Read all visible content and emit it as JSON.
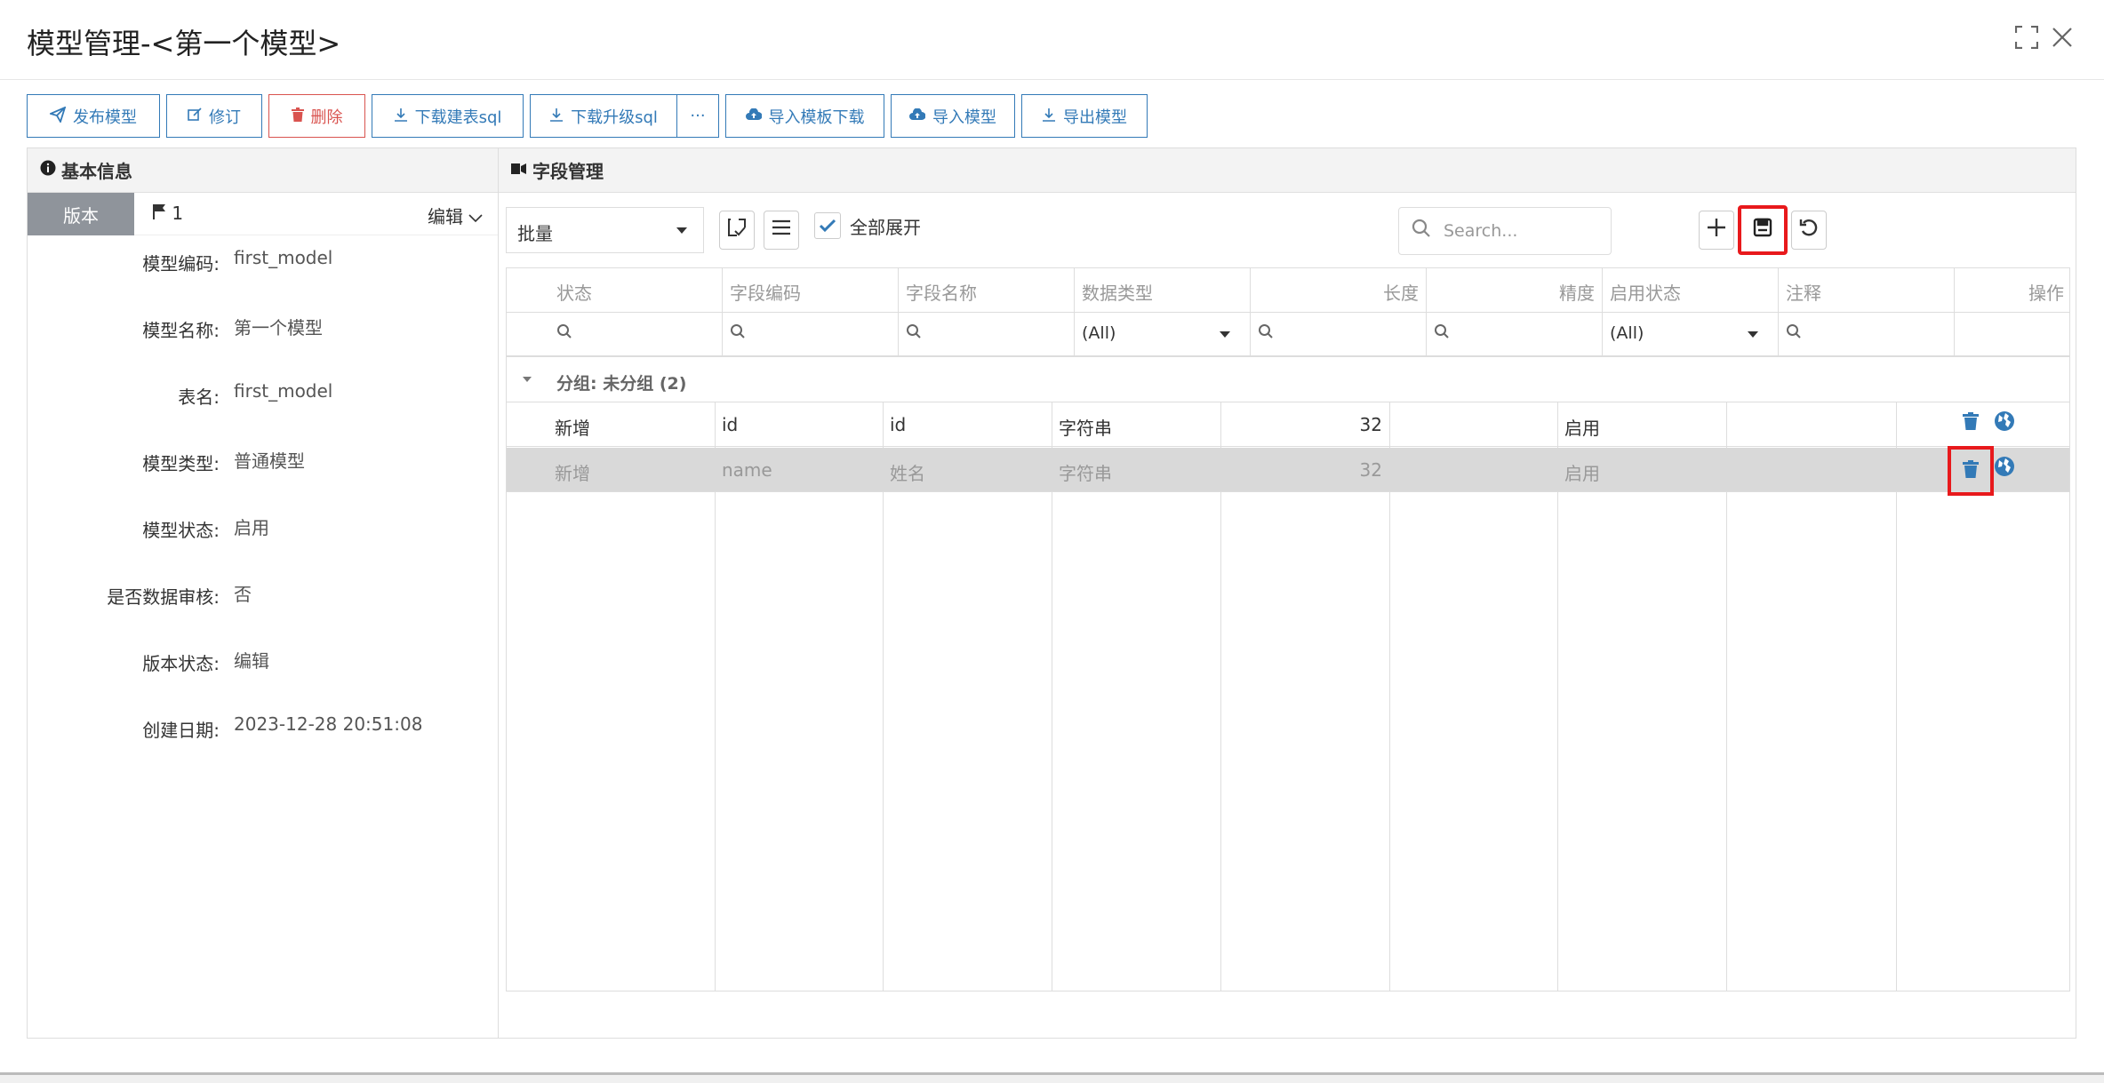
{
  "window": {
    "title": "模型管理-<第一个模型>"
  },
  "toolbar": {
    "buttons": [
      {
        "label": "发布模型",
        "icon": "send-icon"
      },
      {
        "label": "修订",
        "icon": "edit-icon"
      },
      {
        "label": "删除",
        "icon": "trash-icon"
      },
      {
        "label": "下载建表sql",
        "icon": "download-icon"
      },
      {
        "label": "下载升级sql",
        "icon": "download-icon"
      },
      {
        "label": "导入模板下载",
        "icon": "cloud-upload-icon"
      },
      {
        "label": "导入模型",
        "icon": "cloud-upload-icon"
      },
      {
        "label": "导出模型",
        "icon": "download-icon"
      }
    ],
    "more_label": "···"
  },
  "basic_info": {
    "header": "基本信息",
    "version_tab": "版本",
    "version_value": "1",
    "edit_label": "编辑",
    "fields": [
      {
        "label": "模型编码:",
        "value": "first_model"
      },
      {
        "label": "模型名称:",
        "value": "第一个模型"
      },
      {
        "label": "表名:",
        "value": "first_model"
      },
      {
        "label": "模型类型:",
        "value": "普通模型"
      },
      {
        "label": "模型状态:",
        "value": "启用"
      },
      {
        "label": "是否数据审核:",
        "value": "否"
      },
      {
        "label": "版本状态:",
        "value": "编辑"
      },
      {
        "label": "创建日期:",
        "value": "2023-12-28 20:51:08"
      }
    ]
  },
  "fields_panel": {
    "header": "字段管理",
    "batch_select": "批量",
    "expand_all_label": "全部展开",
    "search_placeholder": "Search...",
    "columns": [
      "状态",
      "字段编码",
      "字段名称",
      "数据类型",
      "长度",
      "精度",
      "启用状态",
      "注释",
      "操作"
    ],
    "filter_all": "(All)",
    "group_label": "分组: 未分组 (2)",
    "rows": [
      {
        "status": "新增",
        "code": "id",
        "name": "id",
        "type": "字符串",
        "length": "32",
        "precision": "",
        "enabled": "启用",
        "comment": ""
      },
      {
        "status": "新增",
        "code": "name",
        "name": "姓名",
        "type": "字符串",
        "length": "32",
        "precision": "",
        "enabled": "启用",
        "comment": ""
      }
    ]
  },
  "colors": {
    "accent": "#337ab7",
    "danger": "#d9534f",
    "highlight": "#e8191c",
    "tab_gray": "#8f949b"
  }
}
